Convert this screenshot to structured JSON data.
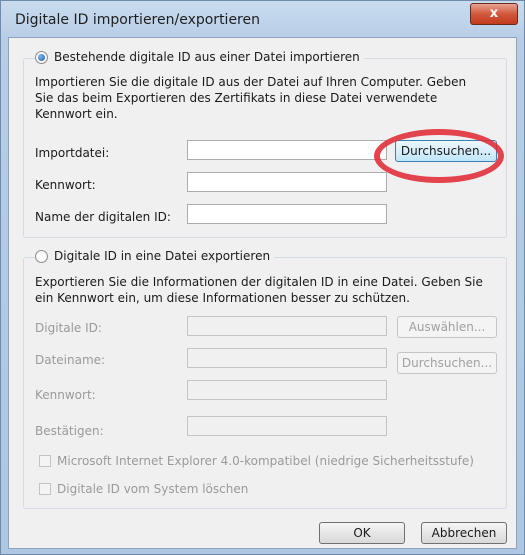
{
  "window": {
    "title": "Digitale ID importieren/exportieren",
    "close": "x"
  },
  "import_section": {
    "radio_label": "Bestehende digitale ID aus einer Datei importieren",
    "description_line1": "Importieren Sie die digitale ID aus der Datei auf Ihren Computer. Geben",
    "description_line2": "Sie das beim Exportieren des Zertifikats in diese Datei verwendete",
    "description_line3": "Kennwort ein.",
    "import_file_label": "Importdatei:",
    "import_file_value": "",
    "browse_button": "Durchsuchen...",
    "password_label": "Kennwort:",
    "password_value": "",
    "id_name_label": "Name der digitalen ID:",
    "id_name_value": ""
  },
  "export_section": {
    "radio_label": "Digitale ID in eine Datei exportieren",
    "description_line1": "Exportieren Sie die Informationen der digitalen ID in eine Datei. Geben Sie",
    "description_line2": "ein Kennwort ein, um diese Informationen besser zu schützen.",
    "digital_id_label": "Digitale ID:",
    "select_button": "Auswählen...",
    "filename_label": "Dateiname:",
    "browse_button": "Durchsuchen...",
    "password_label": "Kennwort:",
    "confirm_label": "Bestätigen:",
    "ie_compat_checkbox": "Microsoft Internet Explorer 4.0-kompatibel (niedrige Sicherheitsstufe)",
    "delete_checkbox": "Digitale ID vom System löschen"
  },
  "footer": {
    "ok": "OK",
    "cancel": "Abbrechen"
  },
  "colors": {
    "annotation_circle": "#e0303a",
    "focus_accent": "#3c7fb1"
  }
}
